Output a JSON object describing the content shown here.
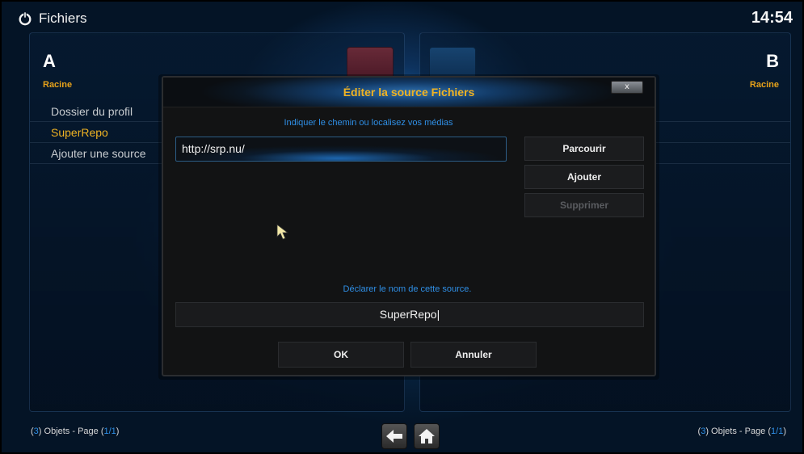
{
  "header": {
    "title": "Fichiers",
    "clock": "14:54",
    "icon": "power-icon"
  },
  "left_pane": {
    "letter": "A",
    "path": "Racine",
    "items": [
      {
        "label": "Dossier du profil",
        "active": false
      },
      {
        "label": "SuperRepo",
        "active": true
      },
      {
        "label": "Ajouter une source",
        "active": false
      }
    ]
  },
  "right_pane": {
    "letter": "B",
    "path": "Racine"
  },
  "footer": {
    "left": {
      "count": "3",
      "prefix": "(",
      "mid": ") Objets - Page (",
      "page": "1/1",
      "suffix": ")"
    },
    "right": {
      "count": "3",
      "prefix": "(",
      "mid": ") Objets - Page (",
      "page": "1/1",
      "suffix": ")"
    },
    "back_icon": "back-arrow-icon",
    "home_icon": "home-icon"
  },
  "dialog": {
    "title": "Éditer la source Fichiers",
    "close_label": "x",
    "path_hint": "Indiquer le chemin ou localisez vos médias",
    "path_value": "http://srp.nu/",
    "browse_label": "Parcourir",
    "add_label": "Ajouter",
    "remove_label": "Supprimer",
    "name_hint": "Déclarer le nom de cette source.",
    "name_value": "SuperRepo|",
    "ok_label": "OK",
    "cancel_label": "Annuler"
  },
  "colors": {
    "accent": "#f0b323",
    "info": "#2f8fe6",
    "background": "#041426"
  }
}
